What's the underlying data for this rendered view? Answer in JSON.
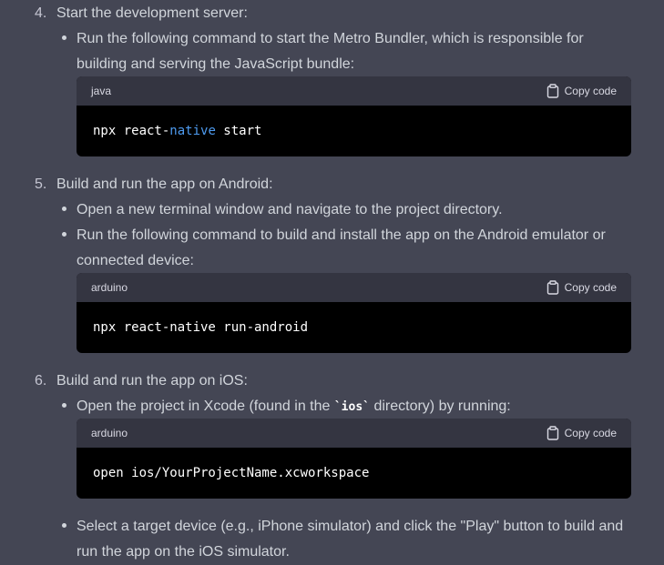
{
  "steps": [
    {
      "number": "4.",
      "title": "Start the development server:",
      "bullets": [
        {
          "text_line1": "Run the following command to start the Metro Bundler, which is responsible for",
          "text_line2": "building and serving the JavaScript bundle:"
        }
      ],
      "code": {
        "language": "java",
        "copy_label": "Copy code",
        "line_part1": "npx react-",
        "line_keyword": "native",
        "line_part2": " start"
      }
    },
    {
      "number": "5.",
      "title": "Build and run the app on Android:",
      "bullets": [
        {
          "text_line1": "Open a new terminal window and navigate to the project directory."
        },
        {
          "text_line1": "Run the following command to build and install the app on the Android emulator or",
          "text_line2": "connected device:"
        }
      ],
      "code": {
        "language": "arduino",
        "copy_label": "Copy code",
        "line": "npx react-native run-android"
      }
    },
    {
      "number": "6.",
      "title": "Build and run the app on iOS:",
      "bullets": [
        {
          "text_before": "Open the project in Xcode (found in the ",
          "inline_code": "`ios`",
          "text_after": " directory) by running:"
        },
        {
          "text_line1": "Select a target device (e.g., iPhone simulator) and click the \"Play\" button to build and",
          "text_line2": "run the app on the iOS simulator."
        }
      ],
      "code": {
        "language": "arduino",
        "copy_label": "Copy code",
        "line": "open ios/YourProjectName.xcworkspace"
      }
    }
  ],
  "icons": {
    "copy": "clipboard-icon"
  },
  "colors": {
    "background": "#444654",
    "text": "#d1d5db",
    "code_header": "#343541",
    "code_body": "#000000",
    "keyword": "#4e9bf0"
  }
}
